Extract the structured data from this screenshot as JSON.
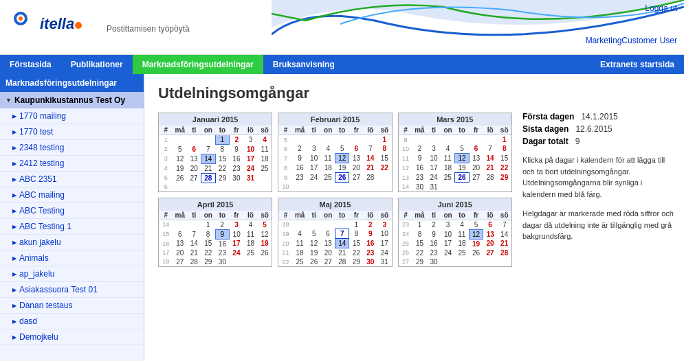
{
  "header": {
    "logo_text": "itella",
    "tagline": "Postittamisen työpöytä",
    "logut_label": "Logga ut",
    "user_name": "MarketingCustomer User"
  },
  "nav": {
    "items": [
      {
        "label": "Förstasida",
        "active": false
      },
      {
        "label": "Publikationer",
        "active": false
      },
      {
        "label": "Marknadsföringsutdelningar",
        "active": true
      },
      {
        "label": "Bruksanvisning",
        "active": false
      }
    ],
    "right_label": "Extranets startsida"
  },
  "sidebar": {
    "title": "Marknadsföringsutdelningar",
    "company": "Kaupunkikustannus Test Oy",
    "items": [
      "1770 mailing",
      "1770 test",
      "2348 testing",
      "2412 testing",
      "ABC 2351",
      "ABC mailing",
      "ABC Testing",
      "ABC Testing 1",
      "akun jakelu",
      "Animals",
      "ap_jakelu",
      "Asiakassuora Test 01",
      "Danan testaus",
      "dasd",
      "Demojkelu"
    ]
  },
  "main": {
    "title": "Utdelningsomgångar",
    "info": {
      "first_day_label": "Första dagen",
      "first_day_value": "14.1.2015",
      "last_day_label": "Sista dagen",
      "last_day_value": "12.6.2015",
      "total_days_label": "Dagar totalt",
      "total_days_value": "9",
      "help_text": "Klicka på dagar i kalendern för att lägga till och ta bort utdelningsomgångar. Utdelningsomgångarna blir synliga i kalendern med blå färg.",
      "holiday_text": "Helgdagar är markerade med röda siffror och dagar då utdelning inte är tillgänglig med grå bakgrundsfärg."
    }
  }
}
